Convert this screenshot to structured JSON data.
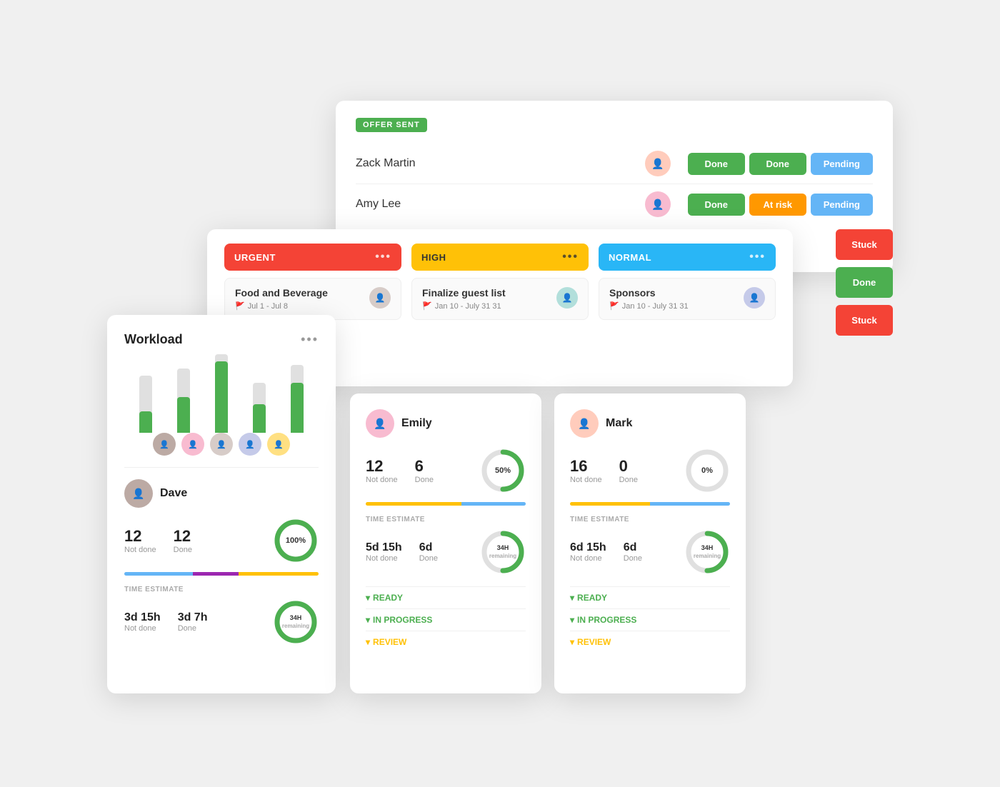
{
  "offer_card": {
    "badge": "OFFER SENT",
    "rows": [
      {
        "name": "Zack Martin",
        "tags": [
          "Done",
          "Done",
          "Pending"
        ],
        "tag_colors": [
          "done",
          "done",
          "pending"
        ]
      },
      {
        "name": "Amy Lee",
        "tags": [
          "Done",
          "At risk",
          "Pending"
        ],
        "tag_colors": [
          "done",
          "atrisk",
          "pending"
        ]
      }
    ]
  },
  "kanban": {
    "columns": [
      {
        "label": "URGENT",
        "style": "urgent",
        "task_title": "Food and Beverage",
        "task_date": "Jul 1 - Jul 8",
        "flag_color": "red"
      },
      {
        "label": "HIGH",
        "style": "high",
        "task_title": "Finalize guest list",
        "task_date": "Jan 10 - July 31 31",
        "flag_color": "yellow"
      },
      {
        "label": "NORMAL",
        "style": "normal",
        "task_title": "Sponsors",
        "task_date": "Jan 10 - July 31 31",
        "flag_color": "blue"
      }
    ],
    "side_tags": [
      "Stuck",
      "Done"
    ]
  },
  "workload": {
    "title": "Workload",
    "bars": [
      {
        "total": 80,
        "filled": 30
      },
      {
        "total": 90,
        "filled": 50
      },
      {
        "total": 110,
        "filled": 90
      },
      {
        "total": 70,
        "filled": 40
      },
      {
        "total": 95,
        "filled": 70
      }
    ],
    "person": {
      "name": "Dave",
      "not_done": 12,
      "done": 12,
      "percent": "100%",
      "time_estimate_label": "TIME ESTIMATE",
      "not_done_time": "3d 15h",
      "done_time": "3d 7h",
      "remaining": "34H"
    }
  },
  "emily_card": {
    "name": "Emily",
    "not_done": 12,
    "done": 6,
    "percent": "50%",
    "donut_pct": 50,
    "time_estimate_label": "TIME ESTIMATE",
    "not_done_time": "5d 15h",
    "done_time": "6d",
    "remaining": "34H",
    "sections": [
      "READY",
      "IN PROGRESS",
      "REVIEW"
    ]
  },
  "mark_card": {
    "name": "Mark",
    "not_done": 16,
    "done": 0,
    "percent": "0%",
    "donut_pct": 0,
    "time_estimate_label": "TIME ESTIMATE",
    "not_done_time": "6d 15h",
    "done_time": "6d",
    "remaining": "34H",
    "sections": [
      "READY",
      "IN PROGRESS",
      "REVIEW"
    ]
  },
  "labels": {
    "not_done": "Not done",
    "done": "Done",
    "stuck": "Stuck",
    "done_tag": "Done"
  }
}
